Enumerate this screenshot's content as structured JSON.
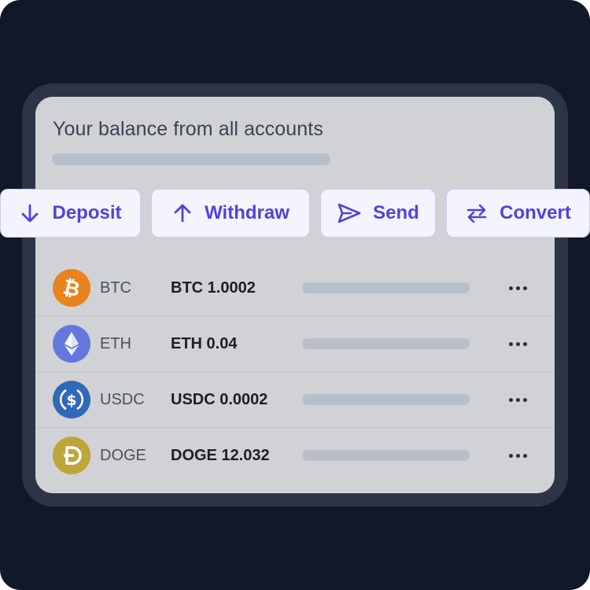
{
  "header": {
    "title": "Your balance from all accounts"
  },
  "actions": {
    "deposit": "Deposit",
    "withdraw": "Withdraw",
    "send": "Send",
    "convert": "Convert"
  },
  "accounts": [
    {
      "ticker": "BTC",
      "amount": "BTC 1.0002",
      "icon": "bitcoin-icon",
      "color": "#e8831d"
    },
    {
      "ticker": "ETH",
      "amount": "ETH 0.04",
      "icon": "ethereum-icon",
      "color": "#6377dd"
    },
    {
      "ticker": "USDC",
      "amount": "USDC 0.0002",
      "icon": "usdc-icon",
      "color": "#2f69b9"
    },
    {
      "ticker": "DOGE",
      "amount": "DOGE 12.032",
      "icon": "dogecoin-icon",
      "color": "#bda53a"
    }
  ],
  "colors": {
    "accent": "#4f44d9",
    "background": "#12172a",
    "card": "#d1d2d5"
  }
}
